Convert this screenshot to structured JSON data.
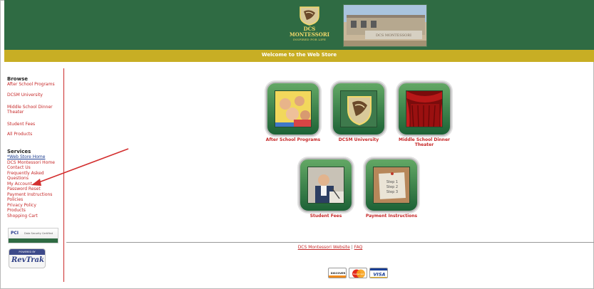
{
  "header": {
    "logo": {
      "line1": "DCS",
      "line2": "MONTESSORI",
      "tagline": "INSPIRED FOR LIFE"
    },
    "photo_sign": "DCS MONTESSORI"
  },
  "banner": {
    "text": "Welcome to the Web Store"
  },
  "sidebar": {
    "browse_heading": "Browse",
    "browse_items": [
      {
        "label": "After School Programs"
      },
      {
        "label": "DCSM University"
      },
      {
        "label": "Middle School Dinner Theater"
      },
      {
        "label": "Student Fees"
      },
      {
        "label": "All Products"
      }
    ],
    "services_heading": "Services",
    "services_items": [
      {
        "label": "*Web Store Home"
      },
      {
        "label": "DCS Montessori Home"
      },
      {
        "label": "Contact Us"
      },
      {
        "label": "Frequently Asked Questions"
      },
      {
        "label": "My Account"
      },
      {
        "label": "Password Reset"
      },
      {
        "label": "Payment Instructions"
      },
      {
        "label": "Policies"
      },
      {
        "label": "Privacy Policy"
      },
      {
        "label": "Products"
      },
      {
        "label": "Shopping Cart"
      }
    ],
    "pci": {
      "main": "PCI",
      "sub": "Data Security Certified"
    },
    "revtrak": {
      "powered_by": "POWERED BY",
      "logo": "RevTrak"
    }
  },
  "tiles": [
    {
      "label": "After School Programs"
    },
    {
      "label": "DCSM University"
    },
    {
      "label": "Middle School Dinner Theater"
    },
    {
      "label": "Student Fees"
    },
    {
      "label": "Payment Instructions"
    }
  ],
  "steps_card": {
    "step1": "Step 1",
    "step2": "Step 2",
    "step3": "Step 3"
  },
  "footer": {
    "link1": "DCS Montessori Website",
    "separator": "|",
    "link2": "FAQ"
  },
  "payment_cards": {
    "discover": "DISCOVER",
    "mastercard": "MasterCard",
    "visa": "VISA"
  },
  "colors": {
    "header_green": "#2f6b43",
    "banner_gold": "#c8ae24",
    "link_red": "#c62828",
    "link_blue": "#1f3f91"
  }
}
